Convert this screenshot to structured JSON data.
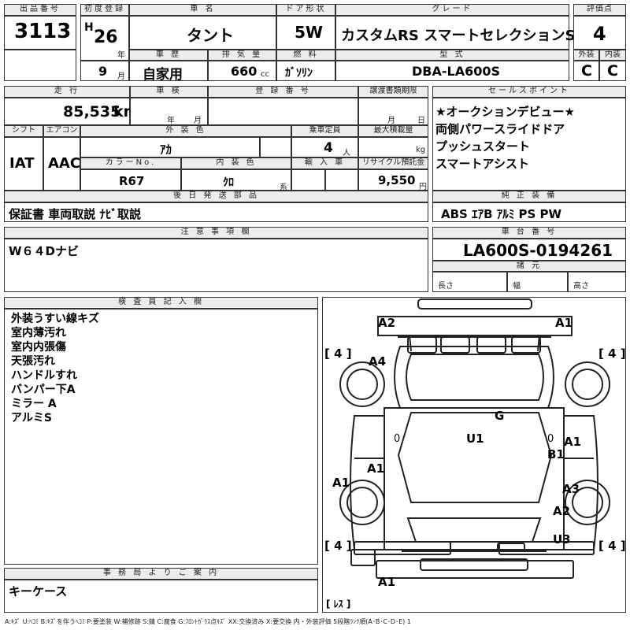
{
  "header": {
    "lot_label": "出品番号",
    "lot": "3113",
    "first_reg_label": "初度登録",
    "era": "H",
    "year": "26",
    "year_unit": "年",
    "month": "9",
    "month_unit": "月",
    "car_name_label": "車 名",
    "car_name": "タント",
    "door_label": "ドア形状",
    "door": "5W",
    "grade_label": "グレード",
    "grade": "カスタムRS スマートセレクションSA",
    "score_label": "評価点",
    "score": "4",
    "history_label": "車 歴",
    "history": "自家用",
    "displacement_label": "排 気 量",
    "displacement": "660",
    "displacement_unit": "cc",
    "fuel_label": "燃 料",
    "fuel": "ｶﾞｿﾘﾝ",
    "model_label": "型 式",
    "model": "DBA-LA600S",
    "exterior_label": "外装",
    "exterior": "C",
    "interior_label": "内装",
    "interior": "C"
  },
  "spec": {
    "mileage_label": "走 行",
    "mileage": "85,535",
    "mileage_unit": "km",
    "inspection_label": "車 検",
    "inspection_year_unit": "年",
    "inspection_month_unit": "月",
    "reg_no_label": "登 録 番 号",
    "transfer_label": "譲渡書類期限",
    "transfer_month_unit": "月",
    "transfer_day_unit": "日",
    "shift_label": "シフト",
    "shift": "IAT",
    "aircon_label": "エアコン",
    "aircon": "AAC",
    "ext_color_label": "外 装 色",
    "ext_color": "ｱｶ",
    "capacity_label": "乗車定員",
    "capacity": "4",
    "capacity_unit": "人",
    "max_load_label": "最大積載量",
    "max_load_unit": "kg",
    "color_no_label": "カラーNo.",
    "color_no": "R67",
    "int_color_label": "内 装 色",
    "int_color": "ｸﾛ",
    "int_color_unit": "系",
    "import_label": "輸 入 車",
    "recycle_label": "リサイクル預託金",
    "recycle": "9,550",
    "recycle_unit": "円"
  },
  "later_parts": {
    "label": "後 日 発 送 部 品",
    "value": "保証書 車両取説 ﾅﾋﾞ取説"
  },
  "sales_points": {
    "label": "セールスポイント",
    "items": [
      "★オークションデビュー★",
      "両側パワースライドドア",
      "プッシュスタート",
      "スマートアシスト"
    ]
  },
  "equipment": {
    "label": "純 正 装 備",
    "value": "ABS ｴｱB ｱﾙﾐ PS PW"
  },
  "caution": {
    "label": "注 意 事 項 欄",
    "value": "W６４Dナビ"
  },
  "chassis": {
    "label": "車 台 番 号",
    "value": "LA600S-0194261",
    "specs_label": "諸 元",
    "length_label": "長さ",
    "width_label": "幅",
    "height_label": "高さ"
  },
  "inspector": {
    "label": "検 査 員 記 入 欄",
    "notes": [
      "外装うすい線キズ",
      "室内薄汚れ",
      "室内内張傷",
      "天張汚れ",
      "ハンドルすれ",
      "バンパー下A",
      "ミラー A",
      "アルミS"
    ]
  },
  "office": {
    "label": "事 務 局 よ り ご 案 内",
    "value": "キーケース"
  },
  "diagram": {
    "marks": [
      "A2",
      "A1",
      "A4",
      "G",
      "U1",
      "A1",
      "B1",
      "A1",
      "A1",
      "A3",
      "A2",
      "U3",
      "A1"
    ],
    "tires": [
      "[ 4 ]",
      "[ 4 ]",
      "[ 4 ]",
      "[ 4 ]"
    ],
    "zeros": [
      "0",
      "0"
    ],
    "spare": "[ ﾚｽ ]"
  },
  "legend": "A:ｷｽﾞ U:ﾍｺﾐ B:ｷｽﾞを伴うﾍｺﾐ P:要塗装 W:補修跡 S:錆 C:腐食 G:ﾌﾛﾝﾄｶﾞﾗｽ点ｷｽﾞ XX:交換済み X:要交換 内・外装評価 5段階ﾗﾝｸ順(A･B･C･D･E) 1"
}
